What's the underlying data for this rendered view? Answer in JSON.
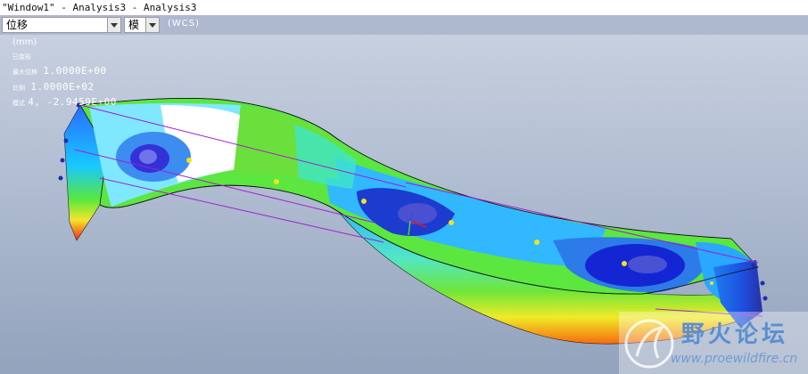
{
  "window": {
    "title": "\"Window1\" - Analysis3 - Analysis3"
  },
  "toolbar": {
    "quantity_select": "位移",
    "mode_select": "模",
    "coordinate_system": "(WCS)"
  },
  "legend": {
    "units": "(mm)",
    "deformed_label": "已变形",
    "max_label": "最大位移",
    "max_value": "1.0000E+00",
    "scale_label": "比例",
    "scale_value": "1.0000E+02",
    "mode_label": "模式",
    "mode_value": "4, -2.9459E+00"
  },
  "watermark": {
    "text": "野火论坛",
    "url": "www.proewildfire.cn"
  },
  "colors": {
    "background_top": "#c6cfdf",
    "background_bottom": "#97a6bf",
    "beam_green": "#5be63f",
    "deep_blue": "#1130d8"
  }
}
